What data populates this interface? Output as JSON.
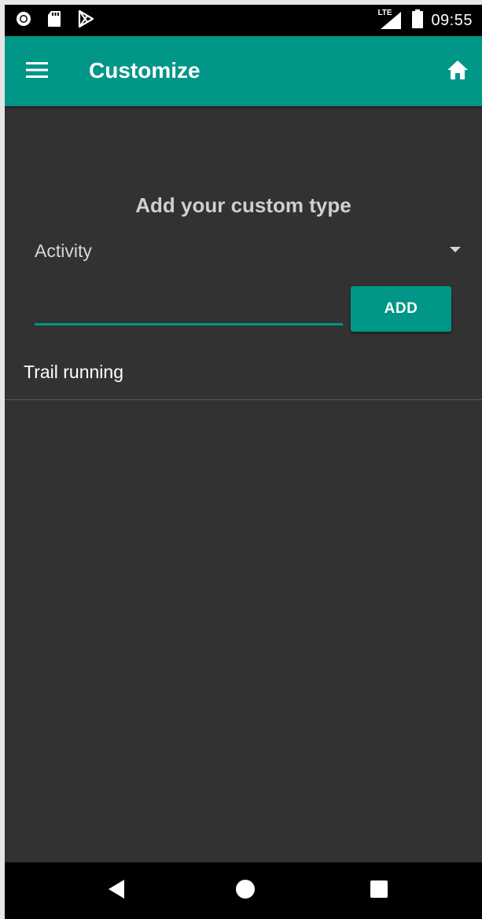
{
  "status_bar": {
    "time": "09:55",
    "network_label": "LTE",
    "icons": [
      "circle-notification-icon",
      "sd-card-icon",
      "play-store-icon",
      "lte-signal-icon",
      "battery-icon"
    ]
  },
  "app_bar": {
    "title": "Customize",
    "menu_icon": "menu-icon",
    "home_icon": "home-icon"
  },
  "form": {
    "heading": "Add your custom type",
    "spinner_value": "Activity",
    "input_value": "",
    "input_placeholder": "",
    "add_label": "ADD"
  },
  "list": {
    "items": [
      {
        "label": "Trail running"
      }
    ]
  },
  "nav_bar": {
    "icons": [
      "back-icon",
      "home-circle-icon",
      "recents-icon"
    ]
  },
  "colors": {
    "accent": "#009688",
    "background": "#323232",
    "status_bar": "#000000"
  }
}
